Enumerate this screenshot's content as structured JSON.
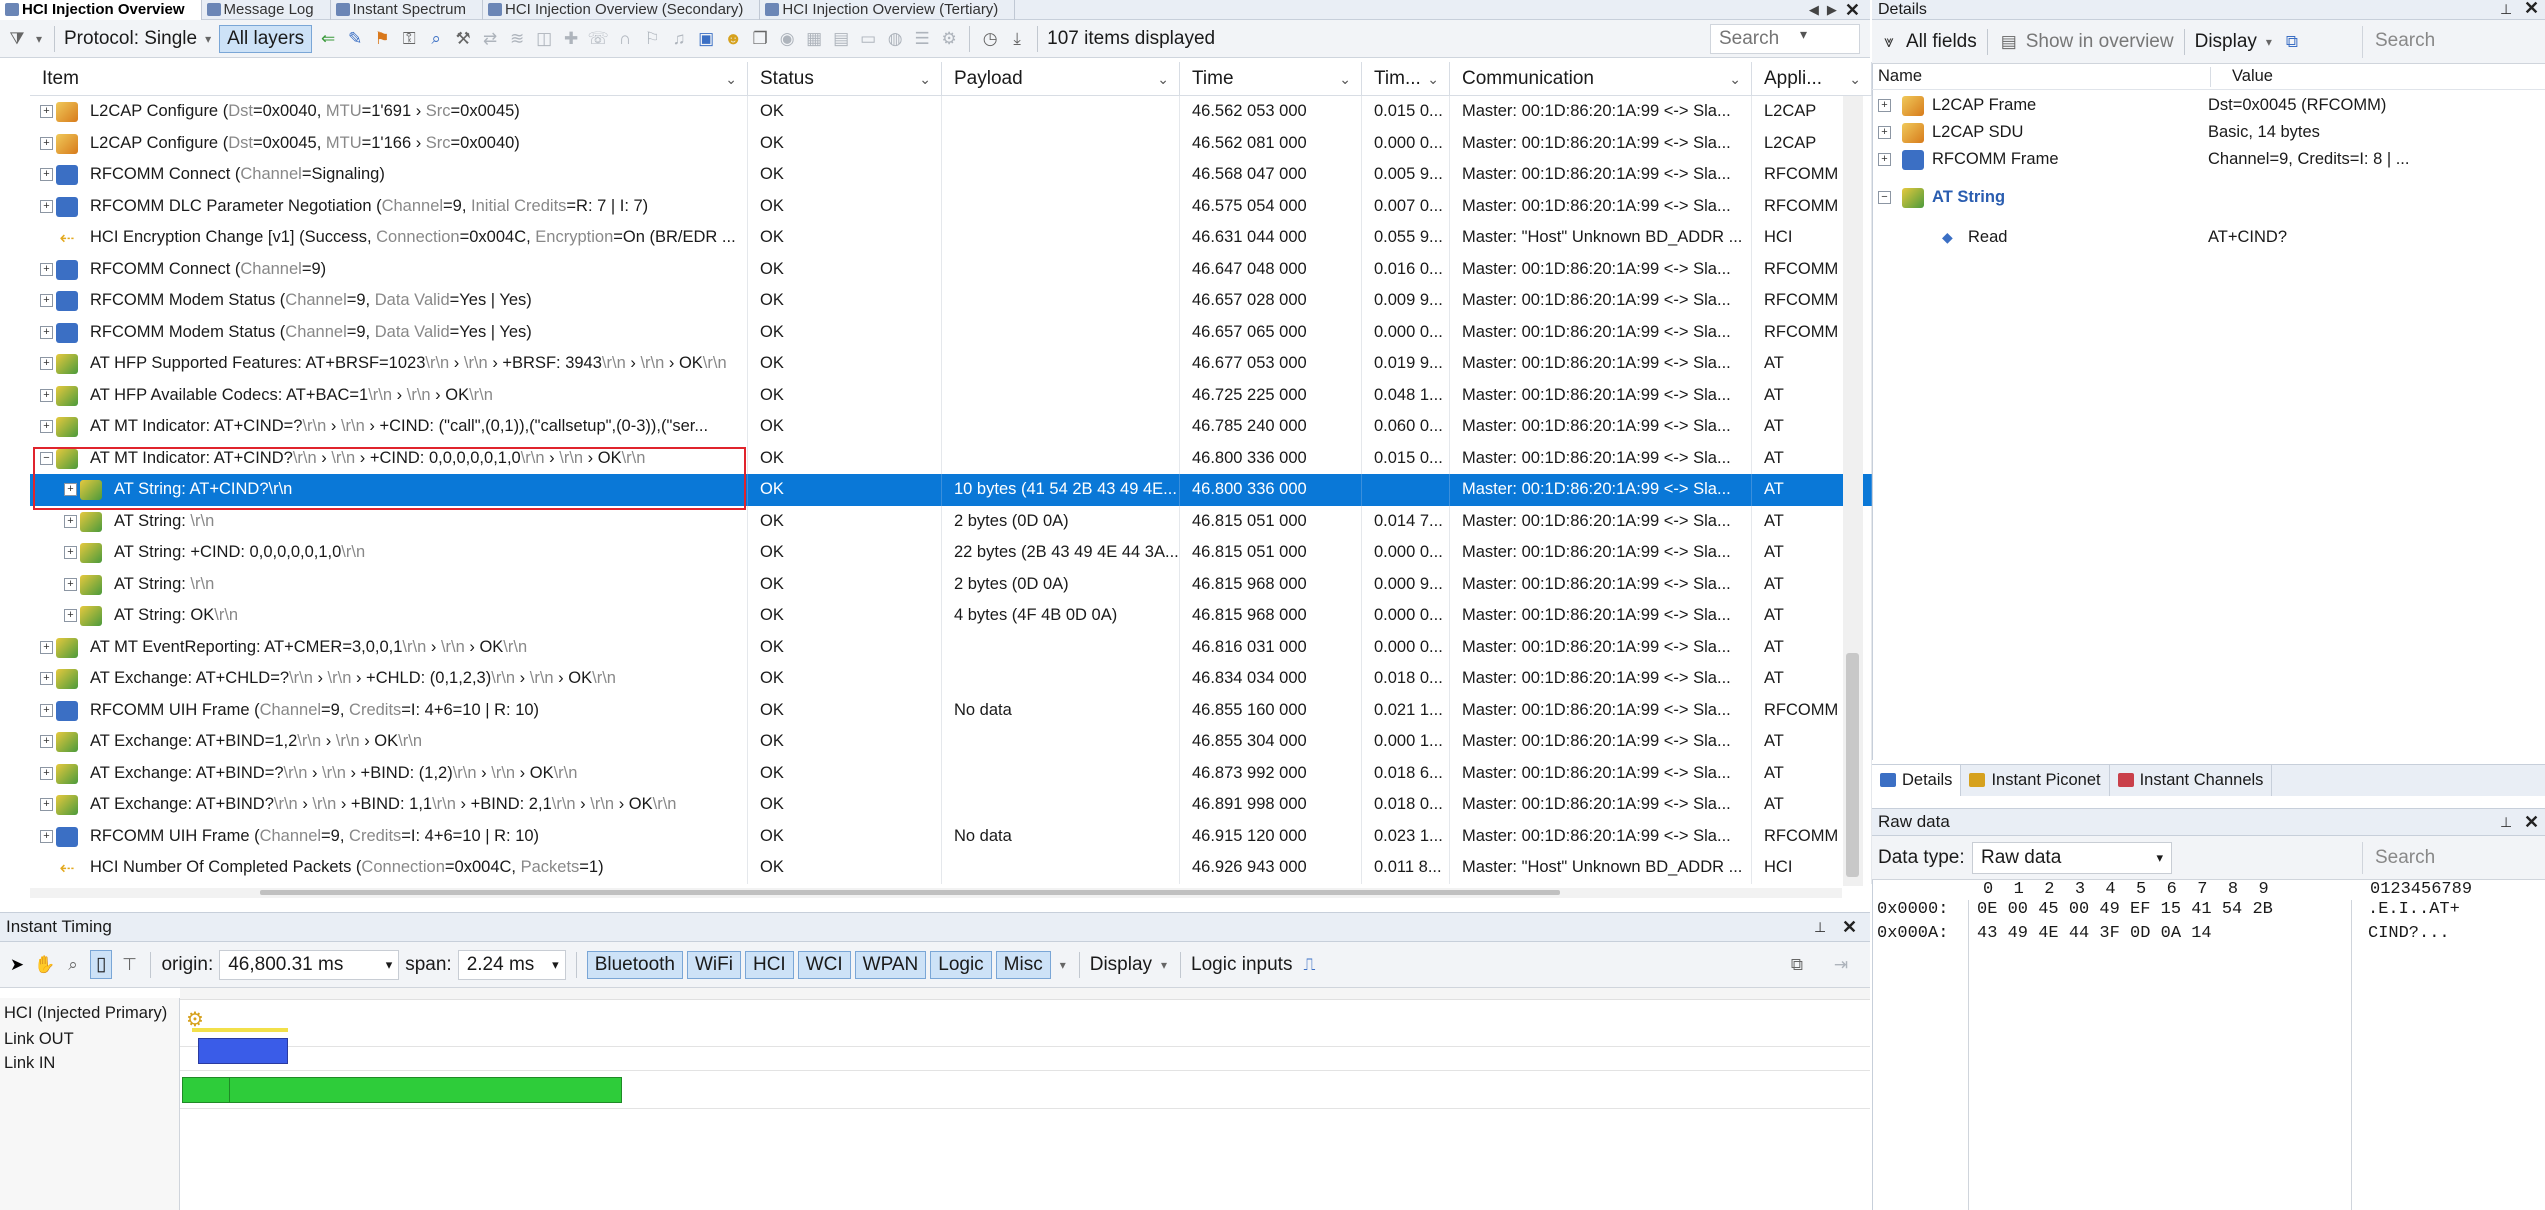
{
  "tabs": [
    {
      "label": "HCI Injection Overview",
      "active": true
    },
    {
      "label": "Message Log",
      "active": false
    },
    {
      "label": "Instant Spectrum",
      "active": false
    },
    {
      "label": "HCI Injection Overview (Secondary)",
      "active": false
    },
    {
      "label": "HCI Injection Overview (Tertiary)",
      "active": false
    }
  ],
  "toolbar": {
    "protocol_label": "Protocol: Single",
    "all_layers_label": "All layers",
    "items_displayed": "107 items displayed",
    "search_placeholder": "Search"
  },
  "columns": [
    {
      "label": "Item"
    },
    {
      "label": "Status"
    },
    {
      "label": "Payload"
    },
    {
      "label": "Time"
    },
    {
      "label": "Tim..."
    },
    {
      "label": "Communication"
    },
    {
      "label": "Appli..."
    }
  ],
  "rows": [
    {
      "indent": 0,
      "icon": "l2cap",
      "parts": [
        [
          "L2CAP Configure (",
          ""
        ],
        [
          "Dst",
          "p"
        ],
        [
          "=0x0040, ",
          ""
        ],
        [
          "MTU",
          "p"
        ],
        [
          "=1'691 › ",
          ""
        ],
        [
          "Src",
          "p"
        ],
        [
          "=0x0045)",
          ""
        ]
      ],
      "status": "OK",
      "payload": "",
      "time": "46.562 053 000",
      "delta": "0.015 0...",
      "comm": "Master: 00:1D:86:20:1A:99 <-> Sla...",
      "app": "L2CAP"
    },
    {
      "indent": 0,
      "icon": "l2cap",
      "parts": [
        [
          "L2CAP Configure (",
          ""
        ],
        [
          "Dst",
          "p"
        ],
        [
          "=0x0045, ",
          ""
        ],
        [
          "MTU",
          "p"
        ],
        [
          "=1'166 › ",
          ""
        ],
        [
          "Src",
          "p"
        ],
        [
          "=0x0040)",
          ""
        ]
      ],
      "status": "OK",
      "payload": "",
      "time": "46.562 081 000",
      "delta": "0.000 0...",
      "comm": "Master: 00:1D:86:20:1A:99 <-> Sla...",
      "app": "L2CAP"
    },
    {
      "indent": 0,
      "icon": "rfcomm",
      "parts": [
        [
          "RFCOMM Connect (",
          ""
        ],
        [
          "Channel",
          "p"
        ],
        [
          "=Signaling)",
          ""
        ]
      ],
      "status": "OK",
      "payload": "",
      "time": "46.568 047 000",
      "delta": "0.005 9...",
      "comm": "Master: 00:1D:86:20:1A:99 <-> Sla...",
      "app": "RFCOMM"
    },
    {
      "indent": 0,
      "icon": "rfcomm",
      "parts": [
        [
          "RFCOMM DLC Parameter Negotiation (",
          ""
        ],
        [
          "Channel",
          "p"
        ],
        [
          "=9, ",
          ""
        ],
        [
          "Initial Credits",
          "p"
        ],
        [
          "=R: 7 | I: 7)",
          ""
        ]
      ],
      "status": "OK",
      "payload": "",
      "time": "46.575 054 000",
      "delta": "0.007 0...",
      "comm": "Master: 00:1D:86:20:1A:99 <-> Sla...",
      "app": "RFCOMM"
    },
    {
      "indent": 0,
      "icon": "hci",
      "parts": [
        [
          "HCI Encryption Change [v1] (Success, ",
          ""
        ],
        [
          "Connection",
          "p"
        ],
        [
          "=0x004C, ",
          ""
        ],
        [
          "Encryption",
          "p"
        ],
        [
          "=On (BR/EDR ...",
          ""
        ]
      ],
      "status": "OK",
      "payload": "",
      "time": "46.631 044 000",
      "delta": "0.055 9...",
      "comm": "Master: \"Host\" Unknown BD_ADDR ...",
      "app": "HCI"
    },
    {
      "indent": 0,
      "icon": "rfcomm",
      "parts": [
        [
          "RFCOMM Connect (",
          ""
        ],
        [
          "Channel",
          "p"
        ],
        [
          "=9)",
          ""
        ]
      ],
      "status": "OK",
      "payload": "",
      "time": "46.647 048 000",
      "delta": "0.016 0...",
      "comm": "Master: 00:1D:86:20:1A:99 <-> Sla...",
      "app": "RFCOMM"
    },
    {
      "indent": 0,
      "icon": "rfcomm",
      "parts": [
        [
          "RFCOMM Modem Status (",
          ""
        ],
        [
          "Channel",
          "p"
        ],
        [
          "=9, ",
          ""
        ],
        [
          "Data Valid",
          "p"
        ],
        [
          "=Yes | Yes)",
          ""
        ]
      ],
      "status": "OK",
      "payload": "",
      "time": "46.657 028 000",
      "delta": "0.009 9...",
      "comm": "Master: 00:1D:86:20:1A:99 <-> Sla...",
      "app": "RFCOMM"
    },
    {
      "indent": 0,
      "icon": "rfcomm",
      "parts": [
        [
          "RFCOMM Modem Status (",
          ""
        ],
        [
          "Channel",
          "p"
        ],
        [
          "=9, ",
          ""
        ],
        [
          "Data Valid",
          "p"
        ],
        [
          "=Yes | Yes)",
          ""
        ]
      ],
      "status": "OK",
      "payload": "",
      "time": "46.657 065 000",
      "delta": "0.000 0...",
      "comm": "Master: 00:1D:86:20:1A:99 <-> Sla...",
      "app": "RFCOMM"
    },
    {
      "indent": 0,
      "icon": "at",
      "parts": [
        [
          "AT HFP Supported Features: AT+BRSF=1023",
          ""
        ],
        [
          "\\r\\n",
          "p"
        ],
        [
          " › ",
          ""
        ],
        [
          "\\r\\n",
          "p"
        ],
        [
          " › +BRSF: 3943",
          ""
        ],
        [
          "\\r\\n",
          "p"
        ],
        [
          " › ",
          ""
        ],
        [
          "\\r\\n",
          "p"
        ],
        [
          " › OK",
          ""
        ],
        [
          "\\r\\n",
          "p"
        ]
      ],
      "status": "OK",
      "payload": "",
      "time": "46.677 053 000",
      "delta": "0.019 9...",
      "comm": "Master: 00:1D:86:20:1A:99 <-> Sla...",
      "app": "AT"
    },
    {
      "indent": 0,
      "icon": "at",
      "parts": [
        [
          "AT HFP Available Codecs: AT+BAC=1",
          ""
        ],
        [
          "\\r\\n",
          "p"
        ],
        [
          " › ",
          ""
        ],
        [
          "\\r\\n",
          "p"
        ],
        [
          " › OK",
          ""
        ],
        [
          "\\r\\n",
          "p"
        ]
      ],
      "status": "OK",
      "payload": "",
      "time": "46.725 225 000",
      "delta": "0.048 1...",
      "comm": "Master: 00:1D:86:20:1A:99 <-> Sla...",
      "app": "AT"
    },
    {
      "indent": 0,
      "icon": "at",
      "parts": [
        [
          "AT MT Indicator: AT+CIND=?",
          ""
        ],
        [
          "\\r\\n",
          "p"
        ],
        [
          " › ",
          ""
        ],
        [
          "\\r\\n",
          "p"
        ],
        [
          " › +CIND: (\"call\",(0,1)),(\"callsetup\",(0-3)),(\"ser...",
          ""
        ]
      ],
      "status": "OK",
      "payload": "",
      "time": "46.785 240 000",
      "delta": "0.060 0...",
      "comm": "Master: 00:1D:86:20:1A:99 <-> Sla...",
      "app": "AT"
    },
    {
      "indent": 0,
      "icon": "at",
      "expanded": true,
      "parts": [
        [
          "AT MT Indicator: AT+CIND?",
          ""
        ],
        [
          "\\r\\n",
          "p"
        ],
        [
          " › ",
          ""
        ],
        [
          "\\r\\n",
          "p"
        ],
        [
          " › +CIND: 0,0,0,0,0,1,0",
          ""
        ],
        [
          "\\r\\n",
          "p"
        ],
        [
          " › ",
          ""
        ],
        [
          "\\r\\n",
          "p"
        ],
        [
          " › OK",
          ""
        ],
        [
          "\\r\\n",
          "p"
        ]
      ],
      "status": "OK",
      "payload": "",
      "time": "46.800 336 000",
      "delta": "0.015 0...",
      "comm": "Master: 00:1D:86:20:1A:99 <-> Sla...",
      "app": "AT"
    },
    {
      "indent": 1,
      "icon": "at",
      "selected": true,
      "parts": [
        [
          "AT String: AT+CIND?\\r\\n",
          ""
        ]
      ],
      "status": "OK",
      "payload": "10 bytes (41 54 2B 43 49 4E...",
      "time": "46.800 336 000",
      "delta": "",
      "comm": "Master: 00:1D:86:20:1A:99 <-> Sla...",
      "app": "AT"
    },
    {
      "indent": 1,
      "icon": "at",
      "parts": [
        [
          "AT String: ",
          ""
        ],
        [
          "\\r\\n",
          "p"
        ]
      ],
      "status": "OK",
      "payload": "2 bytes (0D 0A)",
      "time": "46.815 051 000",
      "delta": "0.014 7...",
      "comm": "Master: 00:1D:86:20:1A:99 <-> Sla...",
      "app": "AT"
    },
    {
      "indent": 1,
      "icon": "at",
      "parts": [
        [
          "AT String: +CIND: 0,0,0,0,0,1,0",
          ""
        ],
        [
          "\\r\\n",
          "p"
        ]
      ],
      "status": "OK",
      "payload": "22 bytes (2B 43 49 4E 44 3A...",
      "time": "46.815 051 000",
      "delta": "0.000 0...",
      "comm": "Master: 00:1D:86:20:1A:99 <-> Sla...",
      "app": "AT"
    },
    {
      "indent": 1,
      "icon": "at",
      "parts": [
        [
          "AT String: ",
          ""
        ],
        [
          "\\r\\n",
          "p"
        ]
      ],
      "status": "OK",
      "payload": "2 bytes (0D 0A)",
      "time": "46.815 968 000",
      "delta": "0.000 9...",
      "comm": "Master: 00:1D:86:20:1A:99 <-> Sla...",
      "app": "AT"
    },
    {
      "indent": 1,
      "icon": "at",
      "parts": [
        [
          "AT String: OK",
          ""
        ],
        [
          "\\r\\n",
          "p"
        ]
      ],
      "status": "OK",
      "payload": "4 bytes (4F 4B 0D 0A)",
      "time": "46.815 968 000",
      "delta": "0.000 0...",
      "comm": "Master: 00:1D:86:20:1A:99 <-> Sla...",
      "app": "AT"
    },
    {
      "indent": 0,
      "icon": "at",
      "parts": [
        [
          "AT MT EventReporting: AT+CMER=3,0,0,1",
          ""
        ],
        [
          "\\r\\n",
          "p"
        ],
        [
          " › ",
          ""
        ],
        [
          "\\r\\n",
          "p"
        ],
        [
          " › OK",
          ""
        ],
        [
          "\\r\\n",
          "p"
        ]
      ],
      "status": "OK",
      "payload": "",
      "time": "46.816 031 000",
      "delta": "0.000 0...",
      "comm": "Master: 00:1D:86:20:1A:99 <-> Sla...",
      "app": "AT"
    },
    {
      "indent": 0,
      "icon": "at",
      "parts": [
        [
          "AT Exchange: AT+CHLD=?",
          ""
        ],
        [
          "\\r\\n",
          "p"
        ],
        [
          " › ",
          ""
        ],
        [
          "\\r\\n",
          "p"
        ],
        [
          " › +CHLD: (0,1,2,3)",
          ""
        ],
        [
          "\\r\\n",
          "p"
        ],
        [
          " › ",
          ""
        ],
        [
          "\\r\\n",
          "p"
        ],
        [
          " › OK",
          ""
        ],
        [
          "\\r\\n",
          "p"
        ]
      ],
      "status": "OK",
      "payload": "",
      "time": "46.834 034 000",
      "delta": "0.018 0...",
      "comm": "Master: 00:1D:86:20:1A:99 <-> Sla...",
      "app": "AT"
    },
    {
      "indent": 0,
      "icon": "rfcomm",
      "parts": [
        [
          "RFCOMM UIH Frame (",
          ""
        ],
        [
          "Channel",
          "p"
        ],
        [
          "=9, ",
          ""
        ],
        [
          "Credits",
          "p"
        ],
        [
          "=I: 4+6=10 | R: 10)",
          ""
        ]
      ],
      "status": "OK",
      "payload": "No data",
      "time": "46.855 160 000",
      "delta": "0.021 1...",
      "comm": "Master: 00:1D:86:20:1A:99 <-> Sla...",
      "app": "RFCOMM"
    },
    {
      "indent": 0,
      "icon": "at",
      "parts": [
        [
          "AT Exchange: AT+BIND=1,2",
          ""
        ],
        [
          "\\r\\n",
          "p"
        ],
        [
          " › ",
          ""
        ],
        [
          "\\r\\n",
          "p"
        ],
        [
          " › OK",
          ""
        ],
        [
          "\\r\\n",
          "p"
        ]
      ],
      "status": "OK",
      "payload": "",
      "time": "46.855 304 000",
      "delta": "0.000 1...",
      "comm": "Master: 00:1D:86:20:1A:99 <-> Sla...",
      "app": "AT"
    },
    {
      "indent": 0,
      "icon": "at",
      "parts": [
        [
          "AT Exchange: AT+BIND=?",
          ""
        ],
        [
          "\\r\\n",
          "p"
        ],
        [
          " › ",
          ""
        ],
        [
          "\\r\\n",
          "p"
        ],
        [
          " › +BIND: (1,2)",
          ""
        ],
        [
          "\\r\\n",
          "p"
        ],
        [
          " › ",
          ""
        ],
        [
          "\\r\\n",
          "p"
        ],
        [
          " › OK",
          ""
        ],
        [
          "\\r\\n",
          "p"
        ]
      ],
      "status": "OK",
      "payload": "",
      "time": "46.873 992 000",
      "delta": "0.018 6...",
      "comm": "Master: 00:1D:86:20:1A:99 <-> Sla...",
      "app": "AT"
    },
    {
      "indent": 0,
      "icon": "at",
      "parts": [
        [
          "AT Exchange: AT+BIND?",
          ""
        ],
        [
          "\\r\\n",
          "p"
        ],
        [
          " › ",
          ""
        ],
        [
          "\\r\\n",
          "p"
        ],
        [
          " › +BIND: 1,1",
          ""
        ],
        [
          "\\r\\n",
          "p"
        ],
        [
          " › +BIND: 2,1",
          ""
        ],
        [
          "\\r\\n",
          "p"
        ],
        [
          " › ",
          ""
        ],
        [
          "\\r\\n",
          "p"
        ],
        [
          " › OK",
          ""
        ],
        [
          "\\r\\n",
          "p"
        ]
      ],
      "status": "OK",
      "payload": "",
      "time": "46.891 998 000",
      "delta": "0.018 0...",
      "comm": "Master: 00:1D:86:20:1A:99 <-> Sla...",
      "app": "AT"
    },
    {
      "indent": 0,
      "icon": "rfcomm",
      "parts": [
        [
          "RFCOMM UIH Frame (",
          ""
        ],
        [
          "Channel",
          "p"
        ],
        [
          "=9, ",
          ""
        ],
        [
          "Credits",
          "p"
        ],
        [
          "=I: 4+6=10 | R: 10)",
          ""
        ]
      ],
      "status": "OK",
      "payload": "No data",
      "time": "46.915 120 000",
      "delta": "0.023 1...",
      "comm": "Master: 00:1D:86:20:1A:99 <-> Sla...",
      "app": "RFCOMM"
    },
    {
      "indent": 0,
      "icon": "hci",
      "parts": [
        [
          "HCI Number Of Completed Packets (",
          ""
        ],
        [
          "Connection",
          "p"
        ],
        [
          "=0x004C, ",
          ""
        ],
        [
          "Packets",
          "p"
        ],
        [
          "=1)",
          ""
        ]
      ],
      "status": "OK",
      "payload": "",
      "time": "46.926 943 000",
      "delta": "0.011 8...",
      "comm": "Master: \"Host\" Unknown BD_ADDR ...",
      "app": "HCI"
    }
  ],
  "timing": {
    "title": "Instant Timing",
    "origin_label": "origin:",
    "origin_value": "46,800.31 ms",
    "span_label": "span:",
    "span_value": "2.24 ms",
    "filters": [
      "Bluetooth",
      "WiFi",
      "HCI",
      "WCI",
      "WPAN",
      "Logic",
      "Misc"
    ],
    "display_label": "Display",
    "logic_inputs_label": "Logic inputs",
    "lanes": [
      "HCI (Injected Primary)",
      "Link OUT",
      "Link IN"
    ],
    "colors": {
      "link_out": "#3a5ce8",
      "link_in": "#2ecc3a",
      "hci_bar": "#f2e04a"
    }
  },
  "details": {
    "title": "Details",
    "all_fields_label": "All fields",
    "show_overview_label": "Show in overview",
    "display_label": "Display",
    "search_placeholder": "Search",
    "col_name": "Name",
    "col_value": "Value",
    "rows": [
      {
        "name": "L2CAP Frame",
        "value": "Dst=0x0045 (RFCOMM)",
        "icon": "l2cap"
      },
      {
        "name": "L2CAP SDU",
        "value": "Basic, 14 bytes",
        "icon": "l2cap"
      },
      {
        "name": "RFCOMM Frame",
        "value": "Channel=9, Credits=I: 8 | ...",
        "icon": "rfcomm"
      }
    ],
    "at_string_label": "AT String",
    "read_label": "Read",
    "read_value": "AT+CIND?",
    "tabs": [
      "Details",
      "Instant Piconet",
      "Instant Channels"
    ]
  },
  "raw": {
    "title": "Raw data",
    "data_type_label": "Data type:",
    "data_type_value": "Raw data",
    "search_placeholder": "Search",
    "header_hex": "0  1  2  3  4  5  6  7  8  9",
    "header_ascii": "0123456789",
    "lines": [
      {
        "offset": "0x0000:",
        "hex": "0E 00 45 00 49 EF 15 41 54 2B",
        "ascii": ".E.I..AT+"
      },
      {
        "offset": "0x000A:",
        "hex": "43 49 4E 44 3F 0D 0A 14",
        "ascii": "CIND?..."
      }
    ]
  }
}
